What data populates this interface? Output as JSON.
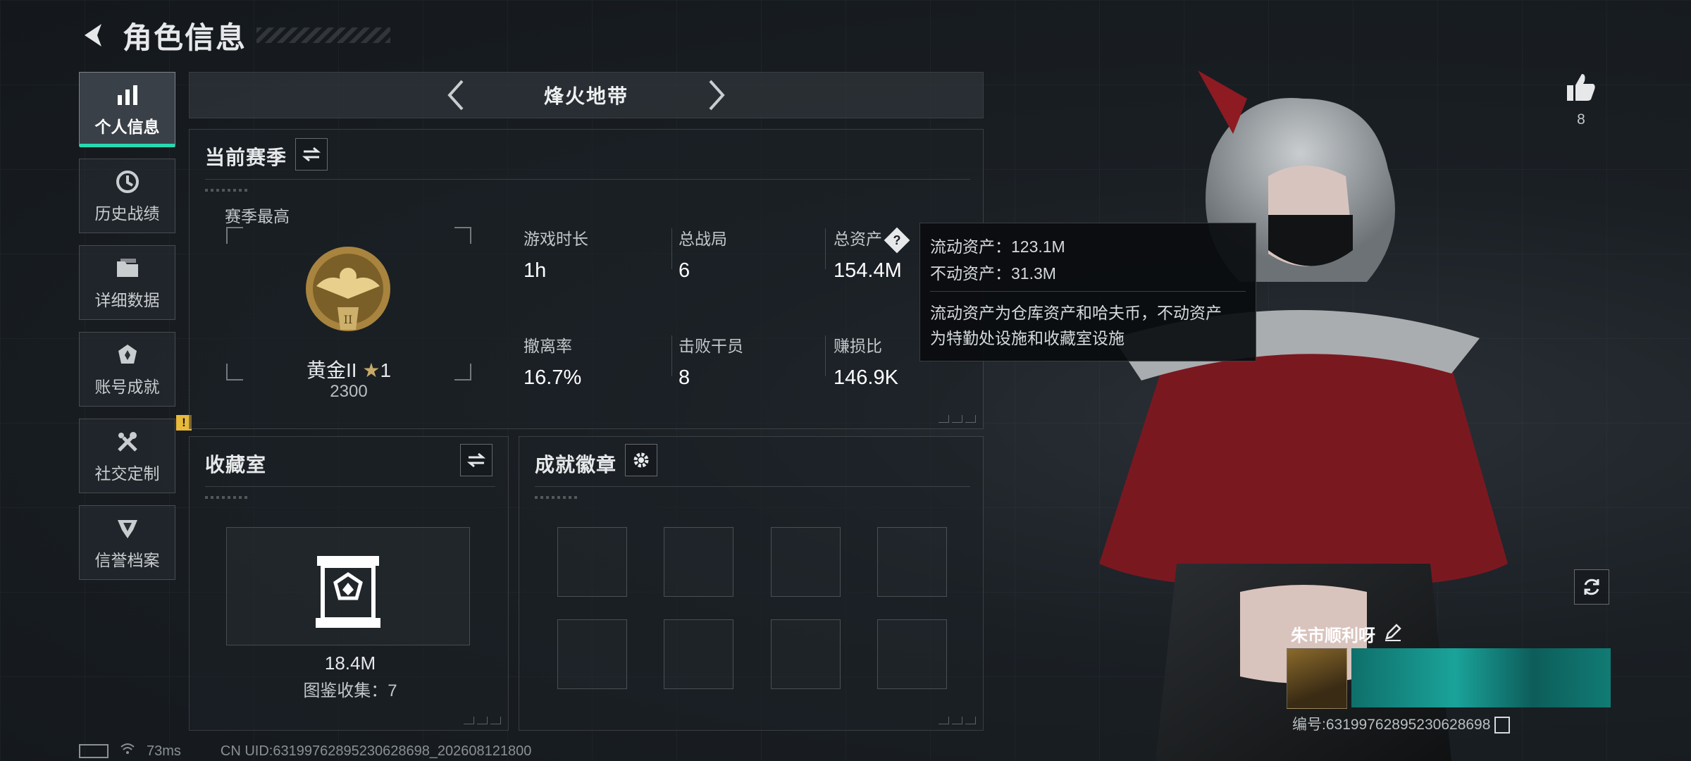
{
  "header": {
    "title": "角色信息"
  },
  "sidebar": {
    "items": [
      {
        "label": "个人信息",
        "icon": "bar-chart-icon",
        "active": true
      },
      {
        "label": "历史战绩",
        "icon": "history-icon"
      },
      {
        "label": "详细数据",
        "icon": "folder-icon"
      },
      {
        "label": "账号成就",
        "icon": "achievement-icon"
      },
      {
        "label": "社交定制",
        "icon": "tools-icon",
        "badge": "!"
      },
      {
        "label": "信誉档案",
        "icon": "reputation-icon"
      }
    ]
  },
  "map_selector": {
    "name": "烽火地带"
  },
  "season": {
    "title": "当前赛季",
    "best_label": "赛季最高",
    "rank_name": "黄金II",
    "rank_stars": "1",
    "rank_score": "2300",
    "stats": [
      {
        "label": "游戏时长",
        "value": "1h"
      },
      {
        "label": "总战局",
        "value": "6"
      },
      {
        "label": "总资产",
        "value": "154.4M",
        "help": "?"
      },
      {
        "label": "撤离率",
        "value": "16.7%"
      },
      {
        "label": "击败干员",
        "value": "8"
      },
      {
        "label": "赚损比",
        "value": "146.9K"
      }
    ]
  },
  "tooltip": {
    "liquid": "流动资产：123.1M",
    "fixed": "不动资产：31.3M",
    "desc_line1": "流动资产为仓库资产和哈夫币，不动资产",
    "desc_line2": "为特勤处设施和收藏室设施"
  },
  "collection": {
    "title": "收藏室",
    "value": "18.4M",
    "count": "图鉴收集：7"
  },
  "achievements": {
    "title": "成就徽章",
    "slots": 8
  },
  "profile": {
    "like_count": "8",
    "player_name": "朱市顺利呀",
    "player_id": "编号:6319976289523062869​8"
  },
  "status_bar": {
    "ping": "73ms",
    "uid": "CN UID:6319976289523062869​8_202608121800"
  },
  "colors": {
    "accent": "#27d9b0",
    "alert": "#e8b93a"
  }
}
